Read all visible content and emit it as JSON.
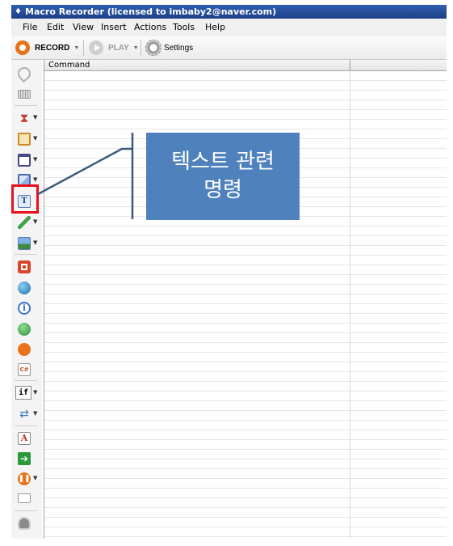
{
  "window": {
    "title": "Macro Recorder (licensed to imbaby2@naver.com)"
  },
  "menu": [
    "File",
    "Edit",
    "View",
    "Insert",
    "Actions",
    "Tools",
    "Help"
  ],
  "toolbar": {
    "record_label": "RECORD",
    "play_label": "PLAY",
    "settings_label": "Settings"
  },
  "grid": {
    "columns": [
      "Command",
      ""
    ]
  },
  "left_toolbar": {
    "if_label": "if",
    "csharp_label": "C#",
    "text_icon_label": "T",
    "font_icon_label": "A"
  },
  "callout": {
    "line1": "텍스트 관련",
    "line2": "명령"
  },
  "colors": {
    "callout_bg": "#4f81bd",
    "highlight": "#e8101a",
    "title_bar": "#1c3f86"
  }
}
